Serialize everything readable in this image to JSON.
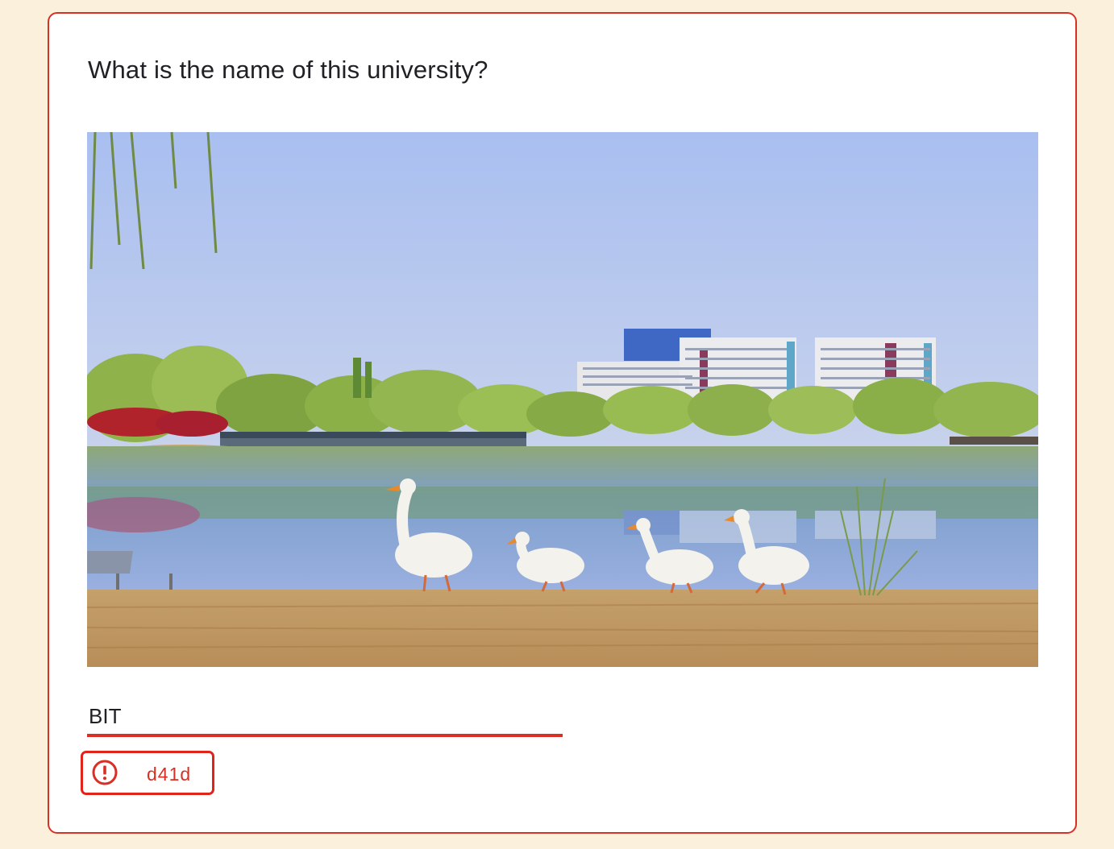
{
  "form": {
    "question_text": "What is the name of this university?",
    "image_icon": "campus-lake-geese-photo",
    "answer_value": "BIT",
    "error_icon": "error-exclamation-icon",
    "error_text": "d41d",
    "colors": {
      "page_background": "#fbf0dc",
      "card_border": "#d93025",
      "error": "#d93025",
      "text": "#202124"
    }
  }
}
